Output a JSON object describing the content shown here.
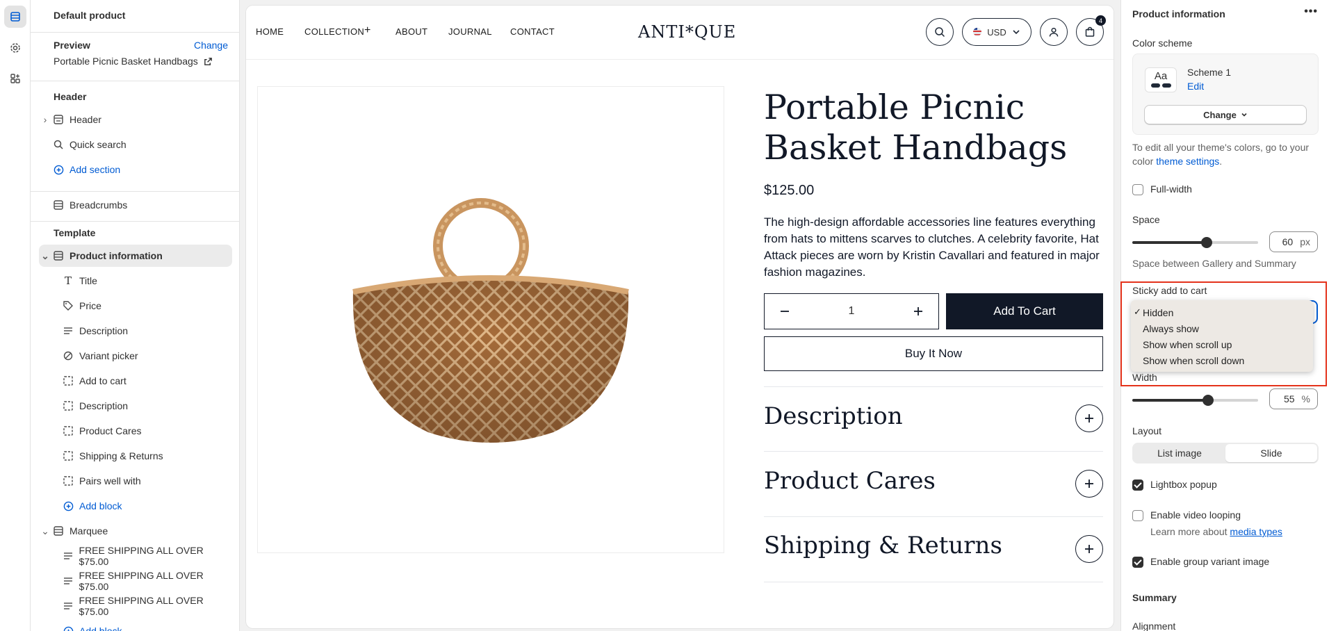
{
  "left_rail": {
    "icons": [
      "sections-icon",
      "settings-gear-icon",
      "apps-icon"
    ]
  },
  "sidebar": {
    "title": "Default product",
    "preview_label": "Preview",
    "change_label": "Change",
    "preview_product": "Portable Picnic Basket Handbags",
    "header_group": "Header",
    "header_items": {
      "header": "Header",
      "quick_search": "Quick search",
      "add_section": "Add section"
    },
    "breadcrumbs": "Breadcrumbs",
    "template_group": "Template",
    "product_information": "Product information",
    "blocks": [
      {
        "label": "Title",
        "icon": "text-icon"
      },
      {
        "label": "Price",
        "icon": "price-tag-icon"
      },
      {
        "label": "Description",
        "icon": "paragraph-icon"
      },
      {
        "label": "Variant picker",
        "icon": "variant-icon"
      },
      {
        "label": "Add to cart",
        "icon": "dashed-square-icon"
      },
      {
        "label": "Description",
        "icon": "dashed-square-icon"
      },
      {
        "label": "Product Cares",
        "icon": "dashed-square-icon"
      },
      {
        "label": "Shipping & Returns",
        "icon": "dashed-square-icon"
      },
      {
        "label": "Pairs well with",
        "icon": "dashed-square-icon"
      }
    ],
    "add_block": "Add block",
    "marquee": "Marquee",
    "marquee_items": [
      "FREE SHIPPING ALL OVER $75.00",
      "FREE SHIPPING ALL OVER $75.00",
      "FREE SHIPPING ALL OVER $75.00"
    ],
    "add_block_2": "Add block"
  },
  "store": {
    "nav": [
      "HOME",
      "COLLECTION",
      "ABOUT",
      "JOURNAL",
      "CONTACT"
    ],
    "logo": "ANTI*QUE",
    "currency": "USD",
    "cart_count": "4",
    "product_title": "Portable Picnic Basket Handbags",
    "price": "$125.00",
    "description": "The high-design affordable accessories line features everything from hats to mittens scarves to clutches. A celebrity favorite, Hat Attack pieces are worn by Kristin Cavallari and featured in major fashion magazines.",
    "quantity": "1",
    "add_to_cart": "Add To Cart",
    "buy_now": "Buy It Now",
    "accordions": [
      "Description",
      "Product Cares",
      "Shipping & Returns"
    ]
  },
  "panel": {
    "title": "Product information",
    "more": "•••",
    "color_scheme_label": "Color scheme",
    "swatch_text": "Aa",
    "scheme_name": "Scheme 1",
    "scheme_edit": "Edit",
    "scheme_change": "Change",
    "help_prefix": "To edit all your theme's colors, go to your color ",
    "help_link": "theme settings",
    "help_suffix": ".",
    "full_width": {
      "label": "Full-width",
      "checked": false
    },
    "space": {
      "label": "Space",
      "value": "60",
      "unit": "px",
      "fraction": 0.59
    },
    "space_help": "Space between Gallery and Summary",
    "sticky_label": "Sticky add to cart",
    "sticky_options": [
      "Hidden",
      "Always show",
      "Show when scroll up",
      "Show when scroll down"
    ],
    "sticky_selected": "Hidden",
    "width": {
      "label": "Width",
      "value": "55",
      "unit": "%",
      "fraction": 0.6
    },
    "layout_label": "Layout",
    "layout_options": [
      "List image",
      "Slide"
    ],
    "layout_selected": "Slide",
    "lightbox": {
      "label": "Lightbox popup",
      "checked": true
    },
    "video_looping": {
      "label": "Enable video looping",
      "checked": false
    },
    "learn_more": "Learn more about ",
    "media_types": "media types",
    "group_variant": {
      "label": "Enable group variant image",
      "checked": true
    },
    "summary": "Summary",
    "alignment": "Alignment"
  },
  "colors": {
    "accent": "#005bd3",
    "dark": "#111827",
    "highlight_frame": "#e4321b",
    "dropdown_bg": "#ede9e4"
  }
}
